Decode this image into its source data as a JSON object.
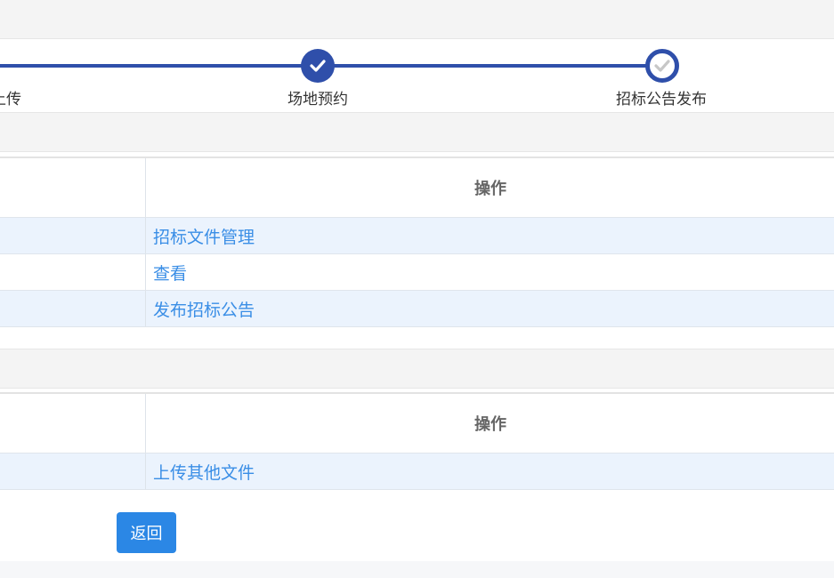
{
  "steps": [
    {
      "label": "上传",
      "status": "done"
    },
    {
      "label": "场地预约",
      "status": "done"
    },
    {
      "label": "招标公告发布",
      "status": "current"
    }
  ],
  "colors": {
    "accent": "#2f4faa",
    "link": "#3a8ee6",
    "button": "#2b87e5",
    "row_alt": "#ebf3fd"
  },
  "table1": {
    "header": "操作",
    "rows": [
      {
        "action": "招标文件管理"
      },
      {
        "action": "查看"
      },
      {
        "action": "发布招标公告"
      }
    ]
  },
  "table2": {
    "header": "操作",
    "rows": [
      {
        "action": "上传其他文件"
      }
    ]
  },
  "back_button": "返回",
  "icons": {
    "step_done": "check-icon",
    "step_current": "check-icon"
  }
}
